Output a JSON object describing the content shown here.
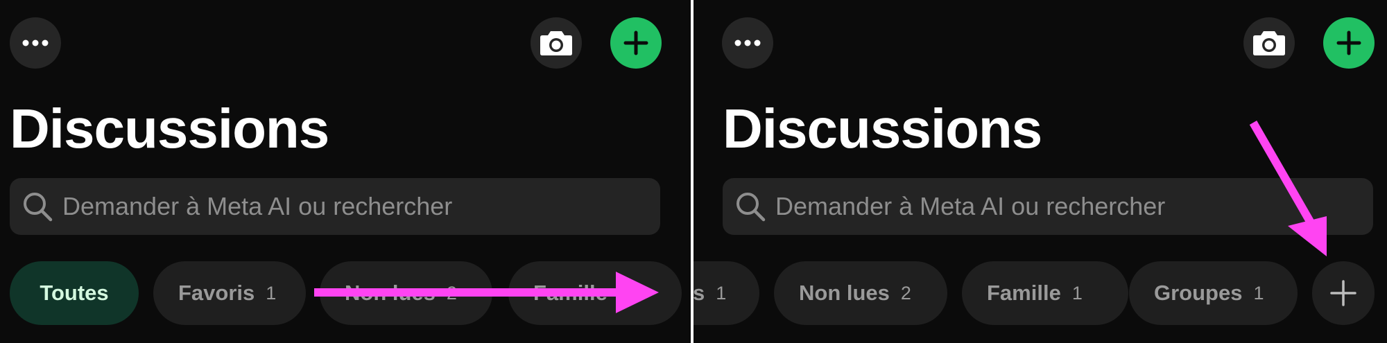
{
  "left": {
    "header": {
      "more_icon": "ellipsis-icon",
      "camera_icon": "camera-icon",
      "new_chat_icon": "plus-icon",
      "new_chat_color": "#21c063"
    },
    "title": "Discussions",
    "search": {
      "placeholder": "Demander à Meta AI ou rechercher",
      "icon": "search-icon"
    },
    "filters": [
      {
        "label": "Toutes",
        "count": "",
        "active": true
      },
      {
        "label": "Favoris",
        "count": "1"
      },
      {
        "label": "Non lues",
        "count": "2"
      },
      {
        "label": "Famille",
        "count": "1"
      }
    ]
  },
  "right": {
    "header": {
      "more_icon": "ellipsis-icon",
      "camera_icon": "camera-icon",
      "new_chat_icon": "plus-icon"
    },
    "title": "Discussions",
    "search": {
      "placeholder": "Demander à Meta AI ou rechercher",
      "icon": "search-icon"
    },
    "filters": [
      {
        "label": "Favoris",
        "count": "1"
      },
      {
        "label": "Non lues",
        "count": "2"
      },
      {
        "label": "Famille",
        "count": "1"
      },
      {
        "label": "Groupes",
        "count": "1"
      }
    ],
    "add_filter_icon": "plus-icon"
  },
  "annotations": {
    "arrow_color": "#ff44f2",
    "arrows": [
      "scroll-right-arrow",
      "point-to-plus-arrow"
    ]
  }
}
